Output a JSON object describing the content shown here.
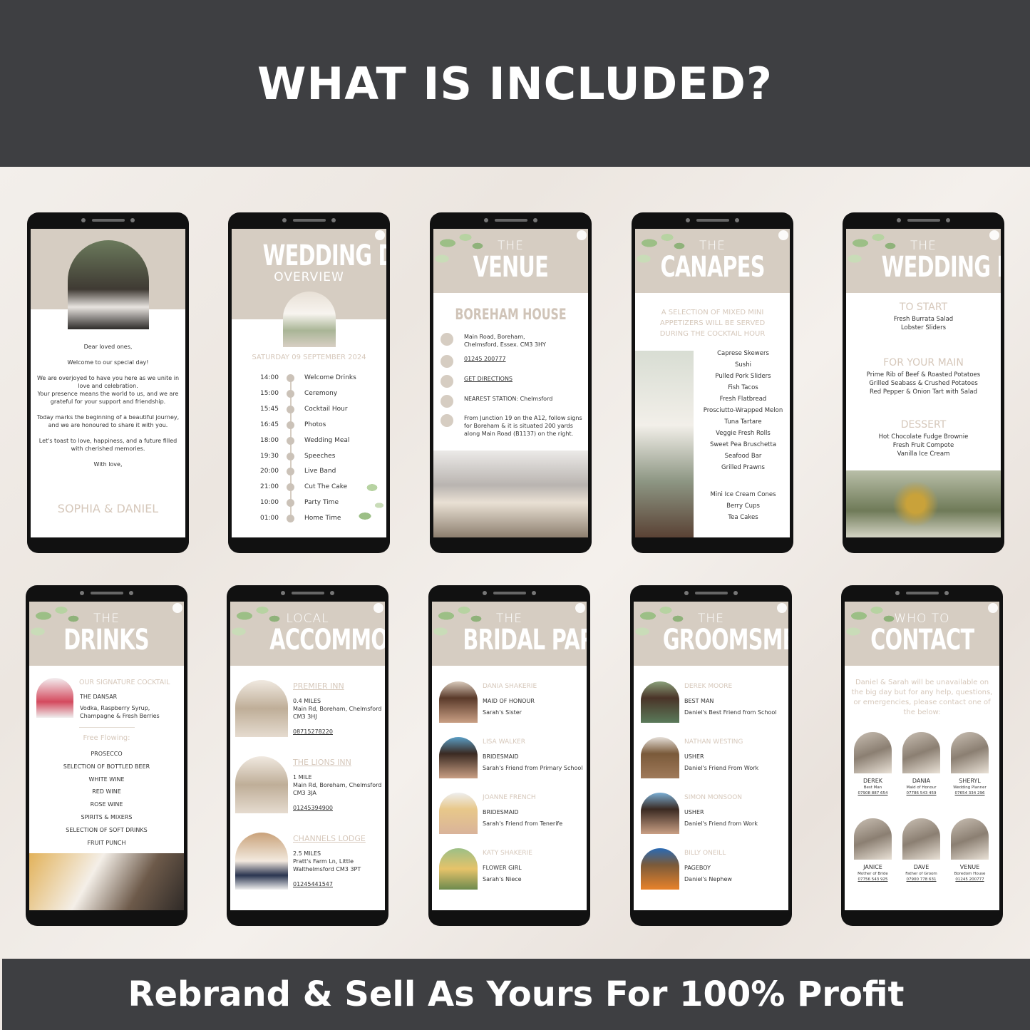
{
  "header": {
    "title": "WHAT IS INCLUDED?"
  },
  "footer": {
    "tagline": "Rebrand & Sell As Yours For 100% Profit"
  },
  "colors": {
    "band": "#3e3f42",
    "accent": "#d6cdc2",
    "accent_text": "#d6c8bb"
  },
  "welcome": {
    "lines": [
      "Dear loved ones,",
      "Welcome to our special day!",
      "We are overjoyed to have you here as we unite in love and celebration.\nYour presence means the world to us, and we are grateful for your support and friendship.",
      "Today marks the beginning of a beautiful journey, and we are honoured to share it with you.",
      "Let's toast to love, happiness, and a future filled with cherished memories.",
      "With love,"
    ],
    "signature": "SOPHIA & DANIEL"
  },
  "overview": {
    "title": "WEDDING DAY",
    "subtitle": "OVERVIEW",
    "date": "SATURDAY 09 SEPTEMBER 2024",
    "timeline": [
      [
        "14:00",
        "Welcome Drinks"
      ],
      [
        "15:00",
        "Ceremony"
      ],
      [
        "15:45",
        "Cocktail Hour"
      ],
      [
        "16:45",
        "Photos"
      ],
      [
        "18:00",
        "Wedding Meal"
      ],
      [
        "19:30",
        "Speeches"
      ],
      [
        "20:00",
        "Live Band"
      ],
      [
        "21:00",
        "Cut The Cake"
      ],
      [
        "10:00",
        "Party Time"
      ],
      [
        "01:00",
        "Home Time"
      ]
    ]
  },
  "venue": {
    "pre": "THE",
    "title": "VENUE",
    "name": "BOREHAM HOUSE",
    "items": [
      {
        "icon": "home-icon",
        "text": "Main Road, Boreham,\nChelmsford, Essex. CM3 3HY",
        "link": false
      },
      {
        "icon": "phone-icon",
        "text": "01245 200777",
        "link": true
      },
      {
        "icon": "location-pin-icon",
        "text": "GET DIRECTIONS",
        "link": true
      },
      {
        "icon": "train-icon",
        "text": "NEAREST STATION: Chelmsford",
        "link": false
      },
      {
        "icon": "car-icon",
        "text": "From Junction 19 on the A12, follow signs for Boreham & it is situated 200 yards along Main Road (B1137) on the right.",
        "link": false
      }
    ]
  },
  "canapes": {
    "pre": "THE",
    "title": "CANAPES",
    "intro": "A SELECTION OF MIXED MINI APPETIZERS WILL BE SERVED DURING THE COCKTAIL HOUR",
    "items": [
      "Caprese Skewers",
      "Sushi",
      "Pulled Pork Sliders",
      "Fish Tacos",
      "Fresh Flatbread",
      "Prosciutto-Wrapped Melon",
      "Tuna Tartare",
      "Veggie Fresh Rolls",
      "Sweet Pea Bruschetta",
      "Seafood Bar",
      "Grilled Prawns"
    ],
    "desserts": [
      "Mini Ice Cream Cones",
      "Berry Cups",
      "Tea Cakes"
    ]
  },
  "menu": {
    "pre": "THE",
    "title": "WEDDING MENU",
    "sections": [
      {
        "heading": "TO START",
        "items": [
          "Fresh Burrata Salad",
          "Lobster Sliders"
        ]
      },
      {
        "heading": "FOR YOUR MAIN",
        "items": [
          "Prime Rib of Beef & Roasted Potatoes",
          "Grilled Seabass & Crushed Potatoes",
          "Red Pepper & Onion Tart with Salad"
        ]
      },
      {
        "heading": "DESSERT",
        "items": [
          "Hot Chocolate Fudge Brownie",
          "Fresh Fruit Compote",
          "Vanilla Ice Cream"
        ]
      }
    ]
  },
  "drinks": {
    "pre": "THE",
    "title": "DRINKS",
    "cocktail_heading": "OUR SIGNATURE COCKTAIL",
    "cocktail_name": "THE DANSAR",
    "cocktail_desc": "Vodka, Raspberry Syrup, Champagne & Fresh Berries",
    "free_heading": "Free Flowing:",
    "items": [
      "PROSECCO",
      "SELECTION OF BOTTLED BEER",
      "WHITE WINE",
      "RED WINE",
      "ROSE WINE",
      "SPIRITS & MIXERS",
      "SELECTION OF SOFT DRINKS",
      "FRUIT PUNCH"
    ]
  },
  "accommodation": {
    "pre": "LOCAL",
    "title": "ACCOMMODATION",
    "hotels": [
      {
        "name": "PREMIER INN",
        "distance": "0.4 MILES",
        "address": "Main Rd, Boreham, Chelmsford CM3 3HJ",
        "phone": "08715278220"
      },
      {
        "name": "THE LIONS INN",
        "distance": "1 MILE",
        "address": "Main Rd, Boreham, Chelmsford CM3 3JA",
        "phone": "01245394900"
      },
      {
        "name": "CHANNELS LODGE",
        "distance": "2.5 MILES",
        "address": "Pratt's Farm Ln, Little Walthelmsford CM3 3PT",
        "phone": "01245441547"
      }
    ]
  },
  "bridal": {
    "pre": "THE",
    "title": "BRIDAL PARTY",
    "people": [
      {
        "name": "DANIA SHAKERIE",
        "role": "MAID OF HONOUR",
        "note": "Sarah's Sister"
      },
      {
        "name": "LISA WALKER",
        "role": "BRIDESMAID",
        "note": "Sarah's Friend from Primary School"
      },
      {
        "name": "JOANNE FRENCH",
        "role": "BRIDESMAID",
        "note": "Sarah's Friend from Tenerife"
      },
      {
        "name": "KATY SHAKERIE",
        "role": "FLOWER GIRL",
        "note": "Sarah's Niece"
      }
    ]
  },
  "groomsmen": {
    "pre": "THE",
    "title": "GROOMSMEN",
    "people": [
      {
        "name": "DEREK MOORE",
        "role": "BEST MAN",
        "note": "Daniel's Best Friend from School"
      },
      {
        "name": "NATHAN WESTING",
        "role": "USHER",
        "note": "Daniel's Friend From Work"
      },
      {
        "name": "SIMON  MONSOON",
        "role": "USHER",
        "note": "Daniel's Friend from Work"
      },
      {
        "name": "BILLY ONEILL",
        "role": "PAGEBOY",
        "note": "Daniel's Nephew"
      }
    ]
  },
  "contact": {
    "pre": "WHO TO",
    "title": "CONTACT",
    "intro": "Daniel & Sarah will be unavailable on the big day but for any help, questions, or emergencies, please contact one of the below:",
    "people": [
      {
        "name": "DEREK",
        "role": "Best Man",
        "phone": "07908 887 654"
      },
      {
        "name": "DANIA",
        "role": "Maid of Honour",
        "phone": "07786 543 459"
      },
      {
        "name": "SHERYL",
        "role": "Wedding Planner",
        "phone": "07654 334 296"
      },
      {
        "name": "JANICE",
        "role": "Mother of Bride",
        "phone": "07756 543 925"
      },
      {
        "name": "DAVE",
        "role": "Father of Groom",
        "phone": "07900 778 631"
      },
      {
        "name": "VENUE",
        "role": "Boredom House",
        "phone": "01245 200777"
      }
    ]
  }
}
